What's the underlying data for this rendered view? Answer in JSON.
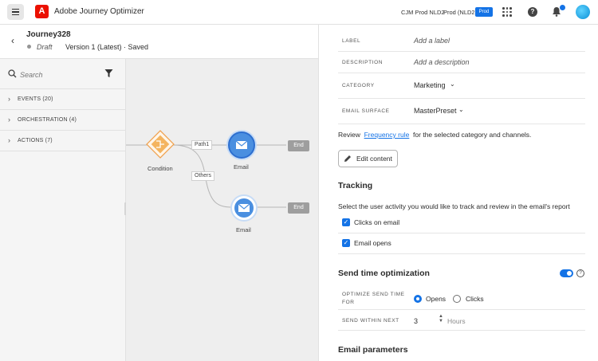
{
  "topbar": {
    "app_title": "Adobe Journey Optimizer",
    "org_name": "CJM Prod NLD2",
    "sandbox_name": "Prod (NLD2)",
    "env_badge": "Prod",
    "brand_color": "#eb1000",
    "accent_color": "#1473e6"
  },
  "journey": {
    "name": "Journey328",
    "status": "Draft",
    "version": "Version 1 (Latest) · Saved"
  },
  "palette": {
    "search_placeholder": "Search",
    "categories": [
      {
        "label": "EVENTS (20)"
      },
      {
        "label": "ORCHESTRATION (4)"
      },
      {
        "label": "ACTIONS (7)"
      }
    ]
  },
  "canvas": {
    "condition_label": "Condition",
    "path1_label": "Path1",
    "others_label": "Others",
    "email1_label": "Email",
    "email2_label": "Email",
    "end1_label": "End",
    "end2_label": "End"
  },
  "properties": {
    "label": {
      "name": "LABEL",
      "placeholder": "Add a label"
    },
    "description": {
      "name": "DESCRIPTION",
      "placeholder": "Add a description"
    },
    "category": {
      "name": "CATEGORY",
      "value": "Marketing"
    },
    "email_surface": {
      "name": "EMAIL SURFACE",
      "value": "MasterPreset"
    },
    "review_prefix": "Review",
    "review_link": "Frequency rule",
    "review_suffix": "for the selected category and channels.",
    "edit_content": "Edit content"
  },
  "tracking": {
    "title": "Tracking",
    "helper": "Select the user activity you would like to track and review in the email's report",
    "options": [
      {
        "label": "Clicks on email",
        "checked": true
      },
      {
        "label": "Email opens",
        "checked": true
      }
    ]
  },
  "send_time": {
    "title": "Send time optimization",
    "enabled": true,
    "optimize_label_1": "OPTIMIZE SEND TIME",
    "optimize_label_2": "FOR",
    "opens": "Opens",
    "clicks": "Clicks",
    "selected": "Opens",
    "within_label": "SEND WITHIN NEXT",
    "within_value": "3",
    "within_units": "Hours"
  },
  "email_parameters": {
    "title": "Email parameters"
  }
}
